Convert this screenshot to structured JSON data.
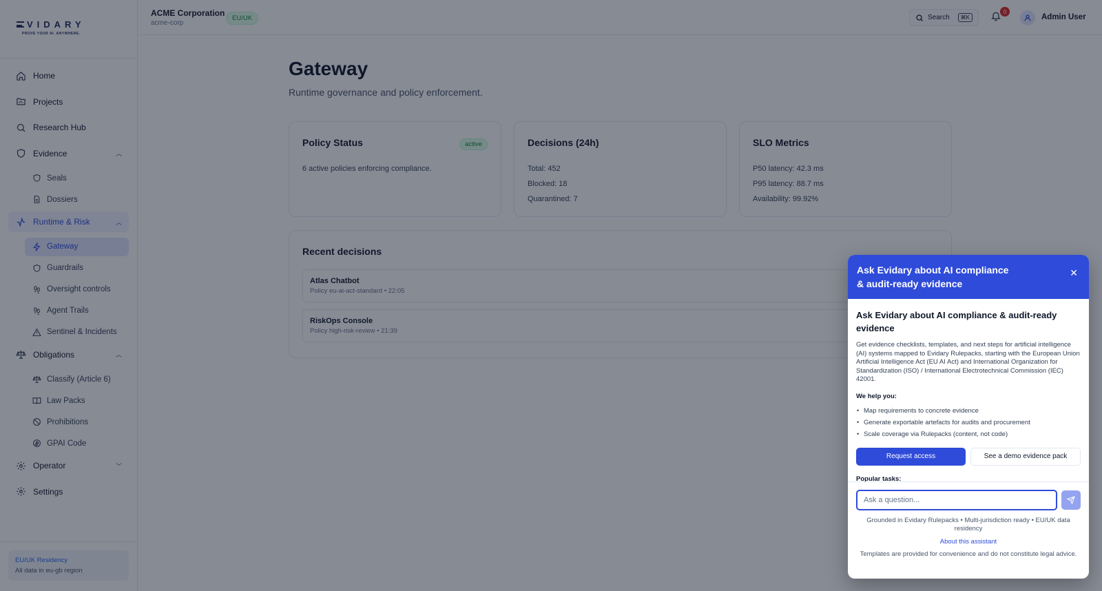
{
  "brand": {
    "name": "VIDARY",
    "tagline": "PROVE YOUR AI. ANYWHERE."
  },
  "header": {
    "org_name": "ACME Corporation",
    "org_slug": "acme-corp",
    "region": "EU/UK",
    "search_label": "Search",
    "search_shortcut": "⌘K",
    "notification_count": "0",
    "user_name": "Admin User"
  },
  "sidebar": {
    "items": [
      {
        "label": "Home",
        "icon": "home-icon"
      },
      {
        "label": "Projects",
        "icon": "folder-icon"
      },
      {
        "label": "Research Hub",
        "icon": "search-icon"
      },
      {
        "label": "Evidence",
        "icon": "shield-icon",
        "expanded": true,
        "children": [
          {
            "label": "Seals",
            "icon": "shield-icon"
          },
          {
            "label": "Dossiers",
            "icon": "file-icon"
          }
        ]
      },
      {
        "label": "Runtime & Risk",
        "icon": "activity-icon",
        "expanded": true,
        "active": true,
        "children": [
          {
            "label": "Gateway",
            "icon": "zap-icon",
            "active": true
          },
          {
            "label": "Guardrails",
            "icon": "shield-icon"
          },
          {
            "label": "Oversight controls",
            "icon": "footprints-icon"
          },
          {
            "label": "Agent Trails",
            "icon": "footprints-icon"
          },
          {
            "label": "Sentinel & Incidents",
            "icon": "alert-triangle-icon"
          }
        ]
      },
      {
        "label": "Obligations",
        "icon": "scale-icon",
        "expanded": true,
        "children": [
          {
            "label": "Classify (Article 6)",
            "icon": "scale-icon"
          },
          {
            "label": "Law Packs",
            "icon": "book-icon"
          },
          {
            "label": "Prohibitions",
            "icon": "ban-icon"
          },
          {
            "label": "GPAI Code",
            "icon": "code-circle-icon"
          }
        ]
      },
      {
        "label": "Operator",
        "icon": "gear-icon",
        "expanded": false
      },
      {
        "label": "Settings",
        "icon": "gear-icon"
      }
    ],
    "residency_title": "EU/UK Residency",
    "residency_sub": "All data in eu-gb region"
  },
  "main": {
    "title": "Gateway",
    "subtitle": "Runtime governance and policy enforcement.",
    "cards": [
      {
        "title": "Policy Status",
        "badge": "active",
        "lines": [
          "6 active policies enforcing compliance."
        ]
      },
      {
        "title": "Decisions (24h)",
        "lines": [
          "Total: 452",
          "Blocked: 18",
          "Quarantined: 7"
        ]
      },
      {
        "title": "SLO Metrics",
        "lines": [
          "P50 latency: 42.3 ms",
          "P95 latency: 88.7 ms",
          "Availability: 99.92%"
        ]
      }
    ],
    "recent_title": "Recent decisions",
    "decisions": [
      {
        "name": "Atlas Chatbot",
        "meta": "Policy eu-ai-act-standard • 22:05"
      },
      {
        "name": "RiskOps Console",
        "meta": "Policy high-risk-review • 21:39"
      }
    ]
  },
  "chat": {
    "header_line1": "Ask Evidary about AI compliance",
    "header_line2": "& audit-ready evidence",
    "heading": "Ask Evidary about AI compliance & audit-ready evidence",
    "description": "Get evidence checklists, templates, and next steps for artificial intelligence (AI) systems mapped to Evidary Rulepacks, starting with the European Union Artificial Intelligence Act (EU AI Act) and International Organization for Standardization (ISO) / International Electrotechnical Commission (IEC) 42001.",
    "help_title": "We help you:",
    "help_items": [
      "Map requirements to concrete evidence",
      "Generate exportable artefacts for audits and procurement",
      "Scale coverage via Rulepacks (content, not code)"
    ],
    "primary_button": "Request access",
    "secondary_button": "See a demo evidence pack",
    "popular_title": "Popular tasks:",
    "input_placeholder": "Ask a question...",
    "note": "Grounded in Evidary Rulepacks • Multi-jurisdiction ready • EU/UK data residency",
    "about_link": "About this assistant",
    "legal": "Templates are provided for convenience and do not constitute legal advice."
  },
  "colors": {
    "accent": "#2f4bd9",
    "success": "#15803d",
    "danger": "#dc2626",
    "overlay": "rgba(15,23,42,0.5)"
  }
}
